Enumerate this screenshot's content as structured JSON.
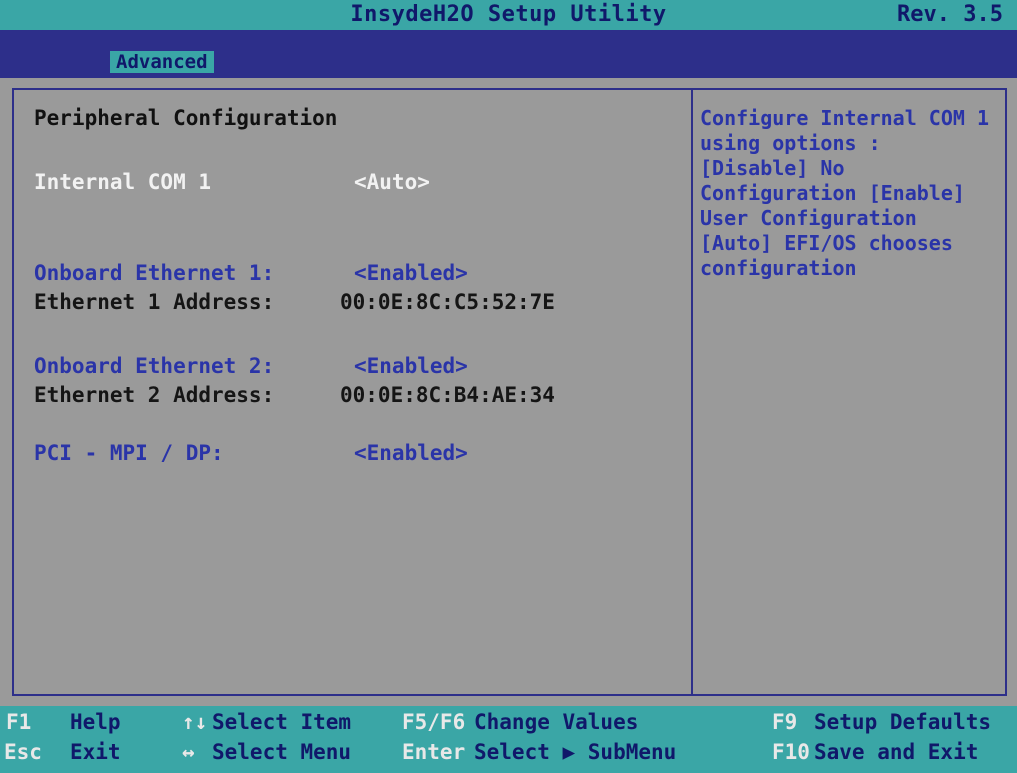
{
  "header": {
    "title": "InsydeH2O Setup Utility",
    "revision": "Rev. 3.5"
  },
  "menu": {
    "active_tab": "Advanced"
  },
  "main": {
    "section_title": "Peripheral Configuration",
    "settings": [
      {
        "label": "Internal COM 1",
        "value": "<Auto>",
        "state": "selected"
      },
      {
        "label": "Onboard Ethernet 1:",
        "value": "<Enabled>",
        "state": "editable"
      },
      {
        "label": "Ethernet 1 Address:",
        "value": "00:0E:8C:C5:52:7E",
        "state": "readonly"
      },
      {
        "label": "Onboard Ethernet 2:",
        "value": "<Enabled>",
        "state": "editable"
      },
      {
        "label": "Ethernet 2 Address:",
        "value": "00:0E:8C:B4:AE:34",
        "state": "readonly"
      },
      {
        "label": "PCI - MPI / DP:",
        "value": "<Enabled>",
        "state": "editable"
      }
    ]
  },
  "help": {
    "lines": [
      "Configure Internal COM 1",
      "using options :",
      "[Disable] No",
      "Configuration [Enable]",
      "User Configuration",
      "[Auto] EFI/OS chooses",
      "configuration"
    ]
  },
  "footer": {
    "items": [
      {
        "key": "F1",
        "action": "Help"
      },
      {
        "key": "↑↓",
        "action": "Select Item"
      },
      {
        "key": "F5/F6",
        "action": "Change Values"
      },
      {
        "key": "F9",
        "action": "Setup Defaults"
      },
      {
        "key": "Esc",
        "action": "Exit"
      },
      {
        "key": "↔",
        "action": "Select Menu"
      },
      {
        "key": "Enter",
        "action": "Select ▶ SubMenu"
      },
      {
        "key": "F10",
        "action": "Save and Exit"
      }
    ]
  },
  "colors": {
    "background": "#9a9a9a",
    "bar_teal": "#3aa6a6",
    "frame_navy": "#2d2f8a",
    "text_blue": "#2a34a8",
    "text_selected": "#f2f2f2"
  }
}
